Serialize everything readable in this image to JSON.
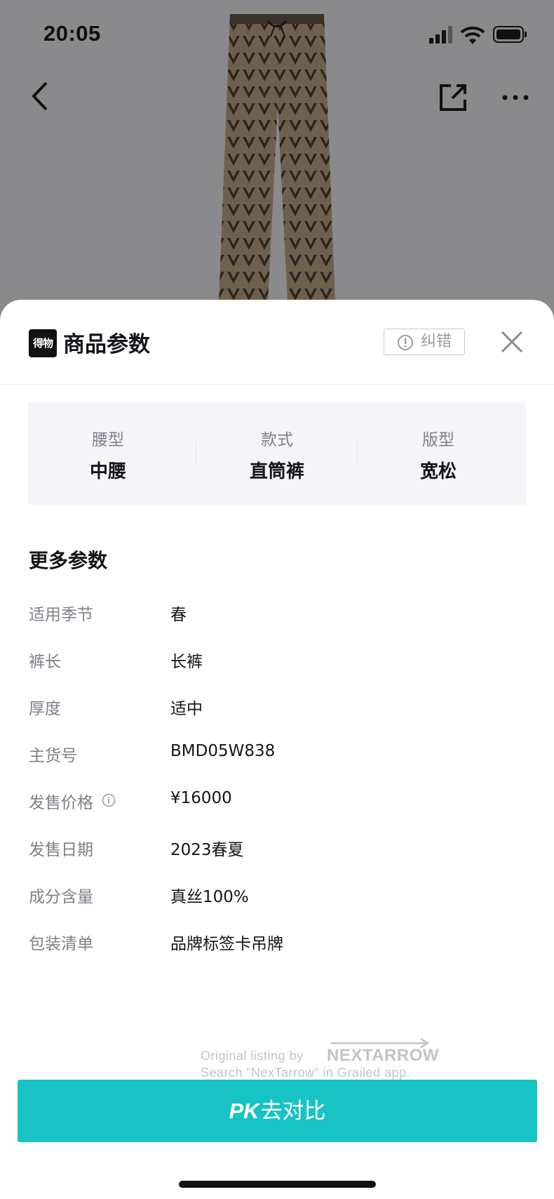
{
  "status_bar": {
    "time": "20:05"
  },
  "nav": {
    "back_icon": "chevron-left-icon",
    "share_icon": "share-external-icon",
    "more_icon": "more-dots-icon"
  },
  "sheet": {
    "logo_text": "得物",
    "title": "商品参数",
    "report_button": "纠错",
    "key_attributes": [
      {
        "label": "腰型",
        "value": "中腰"
      },
      {
        "label": "款式",
        "value": "直筒裤"
      },
      {
        "label": "版型",
        "value": "宽松"
      }
    ],
    "more_title": "更多参数",
    "params": [
      {
        "label": "适用季节",
        "value": "春"
      },
      {
        "label": "裤长",
        "value": "长裤"
      },
      {
        "label": "厚度",
        "value": "适中"
      },
      {
        "label": "主货号",
        "value": "BMD05W838"
      },
      {
        "label": "发售价格",
        "value": "¥16000"
      },
      {
        "label": "发售日期",
        "value": "2023春夏"
      },
      {
        "label": "成分含量",
        "value": "真丝100%"
      },
      {
        "label": "包装清单",
        "value": "品牌标签卡吊牌"
      }
    ]
  },
  "watermark": {
    "line1": "Original listing by",
    "brand": "NEXTARROW",
    "line2": "Search “NexTarrow” in Grailed app."
  },
  "cta": {
    "pk": "PK",
    "label": "去对比"
  },
  "colors": {
    "accent": "#18c3c3",
    "backdrop": "#8a8a8c"
  }
}
